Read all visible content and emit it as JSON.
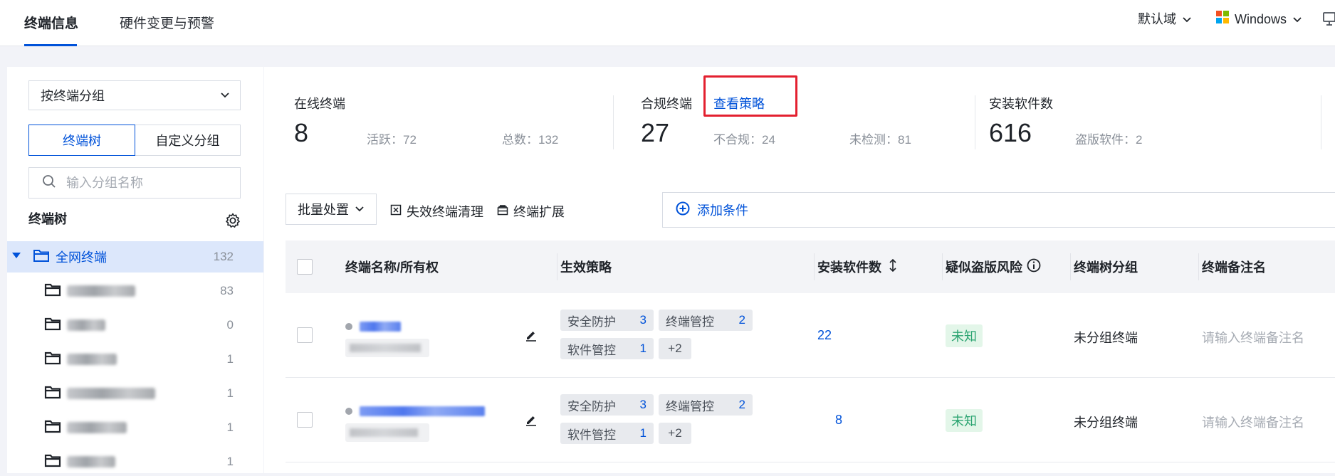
{
  "tabs": [
    {
      "label": "终端信息",
      "active": true
    },
    {
      "label": "硬件变更与预警",
      "active": false
    }
  ],
  "top_right": {
    "domain_select": "默认域",
    "os_select": "Windows"
  },
  "sidebar": {
    "group_by": "按终端分组",
    "segments": [
      "终端树",
      "自定义分组"
    ],
    "search_placeholder": "输入分组名称",
    "tree_title": "终端树",
    "root": {
      "label": "全网终端",
      "count": "132"
    },
    "children_counts": [
      "83",
      "0",
      "1",
      "1",
      "1",
      "1"
    ]
  },
  "stats": {
    "online": {
      "label": "在线终端",
      "value": "8",
      "active": "活跃：72",
      "total": "总数：132"
    },
    "compliant": {
      "label": "合规终端",
      "link": "查看策略",
      "value": "27",
      "noncompliant": "不合规：24",
      "unchecked": "未检测：81"
    },
    "software": {
      "label": "安装软件数",
      "value": "616",
      "pirated": "盗版软件：2"
    }
  },
  "toolbar": {
    "batch": "批量处置",
    "cleanup": "失效终端清理",
    "extend": "终端扩展",
    "add_condition": "添加条件"
  },
  "table": {
    "columns": [
      "终端名称/所有权",
      "生效策略",
      "安装软件数",
      "疑似盗版风险",
      "终端树分组",
      "终端备注名"
    ],
    "rows": [
      {
        "tags": [
          {
            "name": "安全防护",
            "count": "3"
          },
          {
            "name": "终端管控",
            "count": "2"
          },
          {
            "name": "软件管控",
            "count": "1"
          }
        ],
        "more": "+2",
        "software_count": "22",
        "risk": "未知",
        "group": "未分组终端",
        "remark_placeholder": "请输入终端备注名"
      },
      {
        "tags": [
          {
            "name": "安全防护",
            "count": "3"
          },
          {
            "name": "终端管控",
            "count": "2"
          },
          {
            "name": "软件管控",
            "count": "1"
          }
        ],
        "more": "+2",
        "software_count": "8",
        "risk": "未知",
        "group": "未分组终端",
        "remark_placeholder": "请输入终端备注名"
      }
    ]
  },
  "colors": {
    "accent": "#0052d9",
    "highlight": "#e3202f",
    "success": "#2ba471"
  }
}
